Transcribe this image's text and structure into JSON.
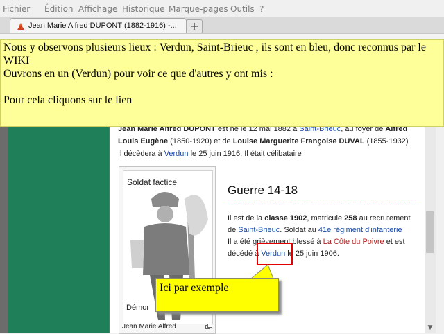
{
  "menubar": {
    "items": [
      "Fichier",
      "Édition",
      "Affichage",
      "Historique",
      "Marque-pages",
      "Outils",
      "?"
    ]
  },
  "tabs": {
    "active_title": "Jean Marie Alfred DUPONT (1882-1916) -...",
    "new_tab_label": "+",
    "tab_icon": "tree-icon"
  },
  "annotation": {
    "line1": "Nous y observons plusieurs lieux : Verdun, Saint-Brieuc , ils sont en bleu, donc reconnus par le WIKI",
    "line2": "Ouvrons en un (Verdun) pour voir ce que d'autres y ont mis :",
    "line3": "Pour cela cliquons sur le lien"
  },
  "intro": {
    "name": "Jean Marie Alfred DUPONT",
    "born_text": " est né le 12 mai 1882 à ",
    "birthplace": "Saint-Brieuc",
    "household": ", au foyer de ",
    "father": "Alfred Louis Eugène",
    "father_years": " (1850-1920) et de ",
    "mother": "Louise Marguerite Françoise DUVAL",
    "mother_years": " (1855-1932)",
    "death_pre": "Il décèdera à ",
    "deathplace": "Verdun",
    "death_post": " le 25 juin 1916. Il était célibataire"
  },
  "image": {
    "caption_top": "Soldat factice",
    "caption_bottom": "Démor",
    "footer": "Jean Marie Alfred"
  },
  "section": {
    "title": "Guerre 14-18",
    "p1": "Il est de la ",
    "p1_class": "classe 1902",
    "p1_b": ", matricule ",
    "p1_mat": "258",
    "p1_c": " au recrutement",
    "p2_de": "de ",
    "p2_place": "Saint-Brieuc",
    "p2_mid": ". Soldat au ",
    "p2_regiment": "41e régiment d'infanterie",
    "p3_pre": "Il a été grièvement blessé à ",
    "p3_place": "La Côte du Poivre",
    "p3_post": " et est",
    "p4_pre": "décédé à ",
    "p4_place": "Verdun",
    "p4_post": " le 25 juin 1906."
  },
  "callout": {
    "text": "Ici par exemple"
  }
}
